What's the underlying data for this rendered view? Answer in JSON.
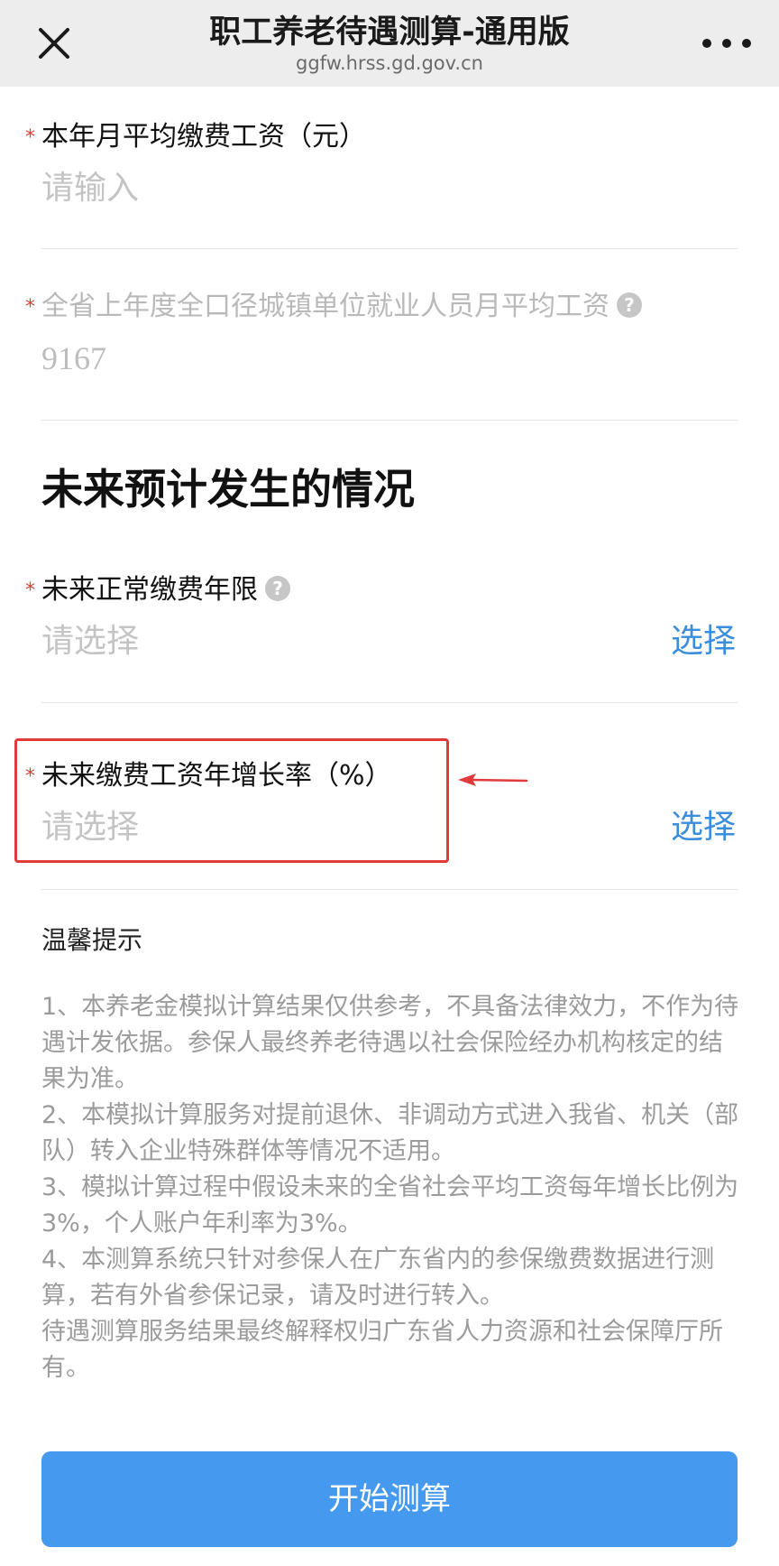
{
  "header": {
    "title": "职工养老待遇测算-通用版",
    "subtitle": "ggfw.hrss.gd.gov.cn",
    "close_icon": "close-icon",
    "more_icon": "more-icon"
  },
  "fields": {
    "monthly_wage": {
      "required_mark": "*",
      "label": "本年月平均缴费工资（元）",
      "placeholder": "请输入"
    },
    "province_avg_wage": {
      "required_mark": "*",
      "label": "全省上年度全口径城镇单位就业人员月平均工资",
      "help": "?",
      "value": "9167"
    }
  },
  "future": {
    "section_title": "未来预计发生的情况",
    "contribution_years": {
      "required_mark": "*",
      "label": "未来正常缴费年限",
      "help": "?",
      "placeholder": "请选择",
      "action": "选择"
    },
    "wage_growth_rate": {
      "required_mark": "*",
      "label": "未来缴费工资年增长率（%）",
      "placeholder": "请选择",
      "action": "选择"
    }
  },
  "annotation": {
    "highlight_color": "#e03a3a"
  },
  "tips": {
    "title": "温馨提示",
    "lines": [
      "1、本养老金模拟计算结果仅供参考，不具备法律效力，不作为待遇计发依据。参保人最终养老待遇以社会保险经办机构核定的结果为准。",
      "2、本模拟计算服务对提前退休、非调动方式进入我省、机关（部队）转入企业特殊群体等情况不适用。",
      "3、模拟计算过程中假设未来的全省社会平均工资每年增长比例为3%，个人账户年利率为3%。",
      "4、本测算系统只针对参保人在广东省内的参保缴费数据进行测算，若有外省参保记录，请及时进行转入。",
      "待遇测算服务结果最终解释权归广东省人力资源和社会保障厅所有。"
    ]
  },
  "actions": {
    "start_label": "开始测算"
  },
  "colors": {
    "accent": "#4599ee",
    "link": "#3b8edb",
    "required": "#e03a3a"
  }
}
